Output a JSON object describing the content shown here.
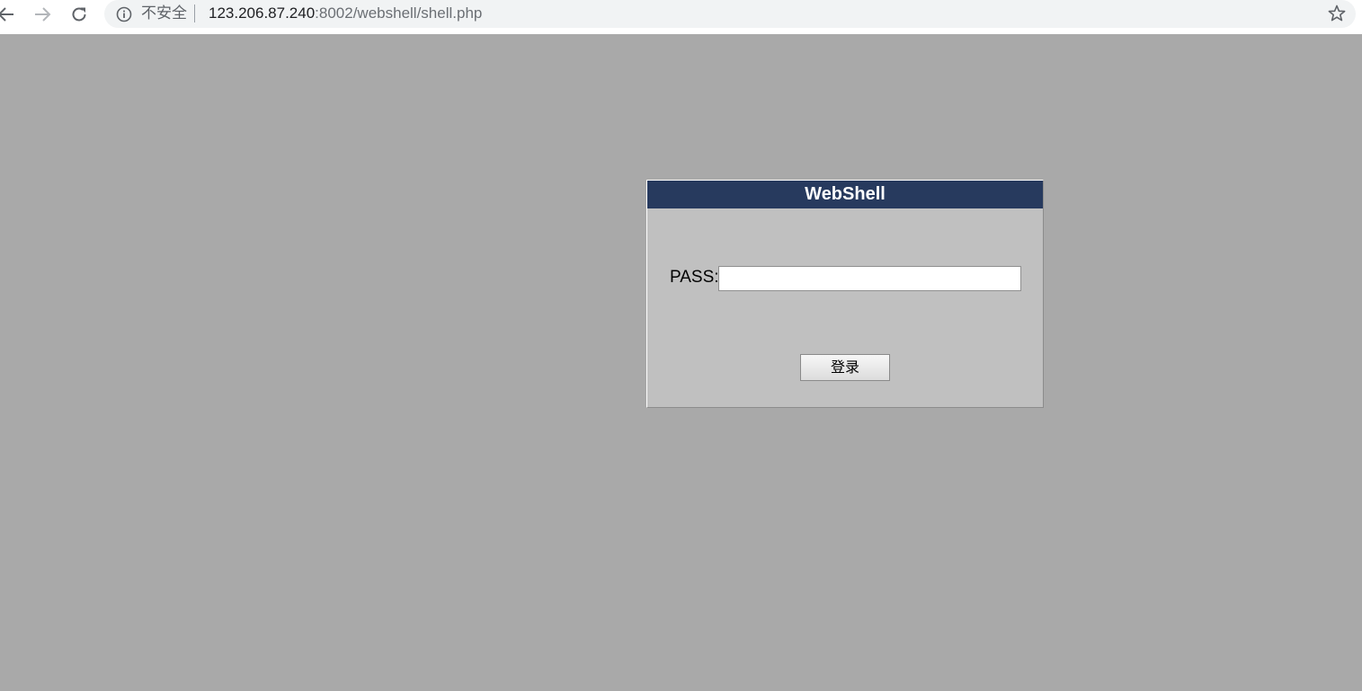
{
  "browser": {
    "security_label": "不安全",
    "url_host": "123.206.87.240",
    "url_rest": ":8002/webshell/shell.php",
    "icons": {
      "back": "arrow-left-icon",
      "forward": "arrow-right-icon",
      "reload": "reload-icon",
      "info": "info-icon",
      "bookmark": "star-icon"
    }
  },
  "login_panel": {
    "title": "WebShell",
    "pass_label": "PASS:",
    "pass_value": "",
    "submit_label": "登录"
  },
  "colors": {
    "page_background": "#a9a9a9",
    "panel_background": "#c0c0c0",
    "panel_header": "#273a5e"
  }
}
